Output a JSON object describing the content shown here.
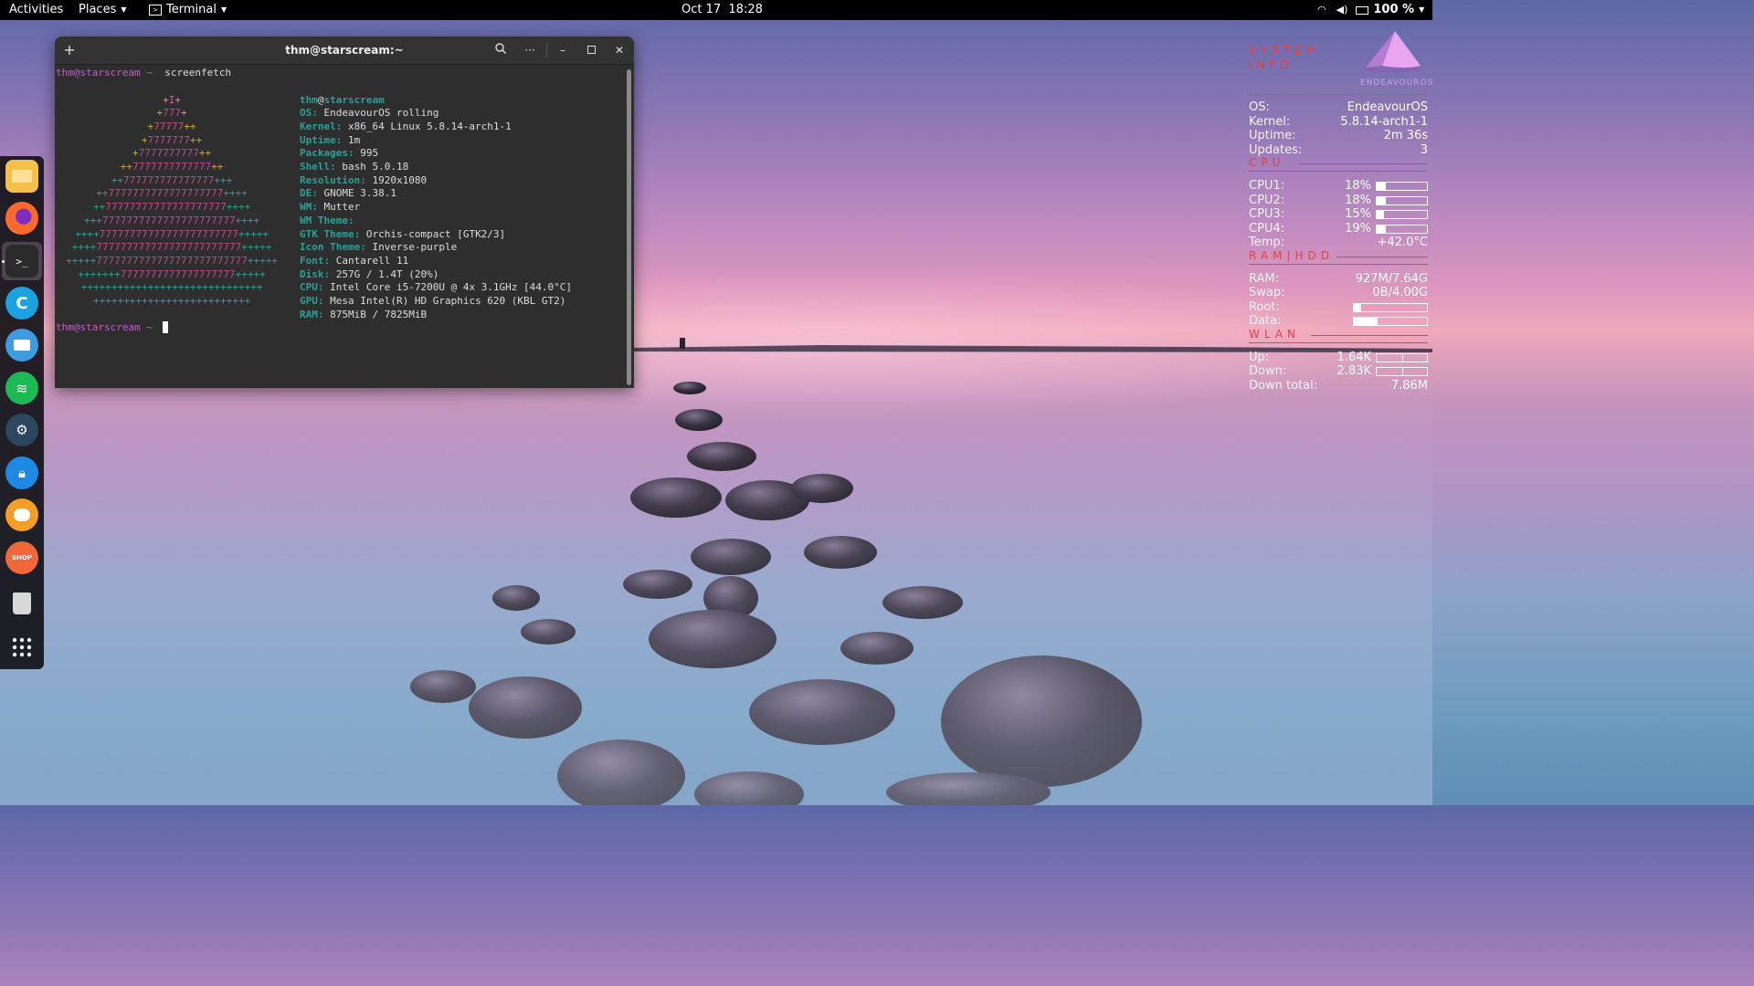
{
  "topbar": {
    "activities": "Activities",
    "places": "Places",
    "terminal": "Terminal",
    "clock": "Oct 17  18:28",
    "battery": "100 %"
  },
  "dock": {
    "items": [
      "files-icon",
      "firefox-icon",
      "terminal-icon",
      "browser-icon",
      "mail-icon",
      "spotify-icon",
      "steam-icon",
      "lock-icon",
      "chat-icon",
      "shop-icon",
      "trash-icon",
      "app-grid-icon"
    ],
    "running_index": 2
  },
  "terminal": {
    "title": "thm@starscream:~",
    "prompt_user": "thm@starscream",
    "prompt_sep": " ~ ",
    "command": "screenfetch",
    "logo": [
      "+I+",
      "+777+",
      "+77777++",
      "+7777777++",
      "+7777777777++",
      "++7777777777777++",
      "++777777777777777+++",
      "++7777777777777777777++++",
      "++77777777777777777777++++",
      "+++7777777777777777777777++++",
      "++++77777777777777777777777+++++",
      "++++777777777777777777777777+++++",
      "+++++7777777777777777777777777+++++",
      "+++++++7777777777777777777+++++",
      "++++++++++++++++++++++++++++++",
      "++++++++++++++++++++++++++"
    ],
    "info_user": "thm",
    "info_at": "@",
    "info_host": "starscream",
    "info": [
      {
        "label": "OS:",
        "value": "EndeavourOS rolling"
      },
      {
        "label": "Kernel:",
        "value": "x86_64 Linux 5.8.14-arch1-1"
      },
      {
        "label": "Uptime:",
        "value": "1m"
      },
      {
        "label": "Packages:",
        "value": "995"
      },
      {
        "label": "Shell:",
        "value": "bash 5.0.18"
      },
      {
        "label": "Resolution:",
        "value": "1920x1080"
      },
      {
        "label": "DE:",
        "value": "GNOME 3.38.1"
      },
      {
        "label": "WM:",
        "value": "Mutter"
      },
      {
        "label": "WM Theme:",
        "value": ""
      },
      {
        "label": "GTK Theme:",
        "value": "Orchis-compact [GTK2/3]"
      },
      {
        "label": "Icon Theme:",
        "value": "Inverse-purple"
      },
      {
        "label": "Font:",
        "value": "Cantarell 11"
      },
      {
        "label": "Disk:",
        "value": "257G / 1.4T (20%)"
      },
      {
        "label": "CPU:",
        "value": "Intel Core i5-7200U @ 4x 3.1GHz [44.0°C]"
      },
      {
        "label": "GPU:",
        "value": "Mesa Intel(R) HD Graphics 620 (KBL GT2)"
      },
      {
        "label": "RAM:",
        "value": "875MiB / 7825MiB"
      }
    ]
  },
  "conky": {
    "title_line1": "SYSTEM",
    "title_line2": "INFO",
    "logo_text": "ENDEAVOUROS",
    "system": [
      {
        "k": "OS:",
        "v": "EndeavourOS"
      },
      {
        "k": "Kernel:",
        "v": "5.8.14-arch1-1"
      },
      {
        "k": "Uptime:",
        "v": "2m 36s"
      },
      {
        "k": "Updates:",
        "v": "3"
      }
    ],
    "cpu_title": "CPU",
    "cpus": [
      {
        "k": "CPU1:",
        "v": "18%",
        "level": 0.18
      },
      {
        "k": "CPU2:",
        "v": "18%",
        "level": 0.18
      },
      {
        "k": "CPU3:",
        "v": "15%",
        "level": 0.15
      },
      {
        "k": "CPU4:",
        "v": "19%",
        "level": 0.19
      }
    ],
    "temp": {
      "k": "Temp:",
      "v": "+42.0°C"
    },
    "ram_title": "RAM|HDD",
    "mem": [
      {
        "k": "RAM:",
        "v": "927M/7.64G"
      },
      {
        "k": "Swap:",
        "v": "0B/4.00G"
      }
    ],
    "disks": [
      {
        "k": "Root:",
        "level": 0.1
      },
      {
        "k": "Data:",
        "level": 0.33
      }
    ],
    "wlan_title": "WLAN",
    "net": [
      {
        "k": "Up:",
        "v": "1.64K",
        "level": 0.5
      },
      {
        "k": "Down:",
        "v": "2.83K",
        "level": 0.5
      }
    ],
    "down_total": {
      "k": "Down total:",
      "v": "7.86M"
    }
  },
  "colors": {
    "accent_red": "#e84040",
    "prompt_magenta": "#c45ec9",
    "label_teal": "#2aa198"
  }
}
